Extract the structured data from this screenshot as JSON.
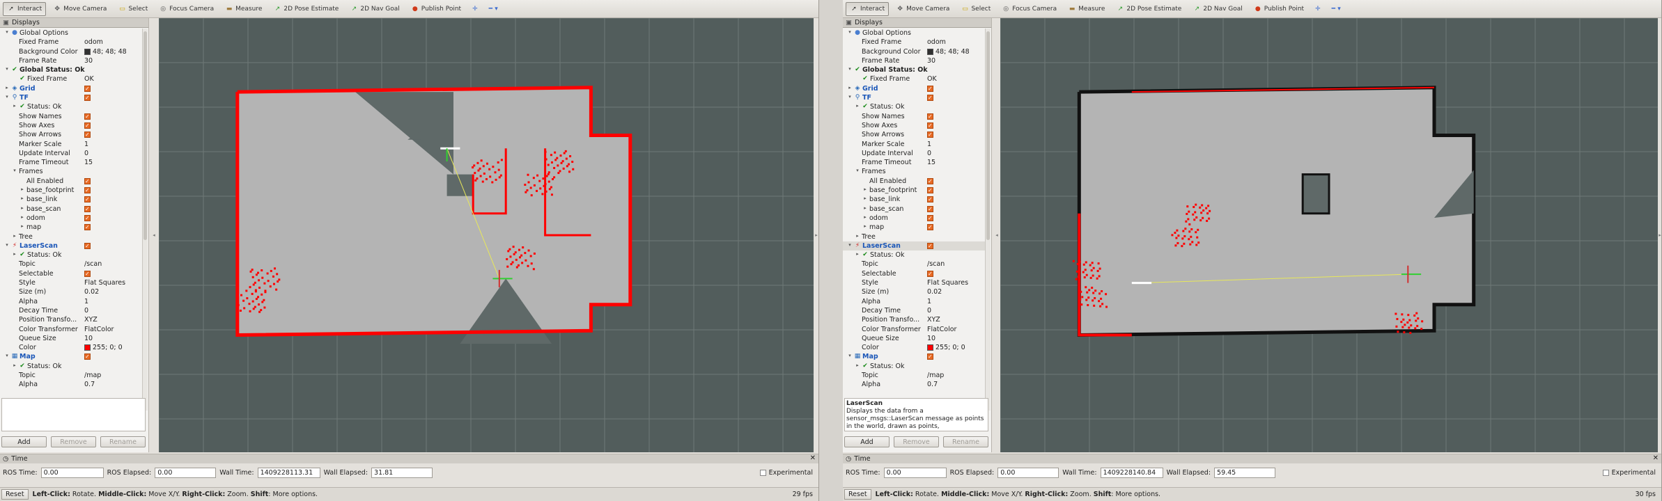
{
  "toolbar": {
    "items": [
      {
        "label": "Interact",
        "icon": "interact-icon"
      },
      {
        "label": "Move Camera",
        "icon": "move-camera-icon"
      },
      {
        "label": "Select",
        "icon": "select-icon"
      },
      {
        "label": "Focus Camera",
        "icon": "focus-camera-icon"
      },
      {
        "label": "Measure",
        "icon": "measure-icon"
      },
      {
        "label": "2D Pose Estimate",
        "icon": "pose-estimate-icon"
      },
      {
        "label": "2D Nav Goal",
        "icon": "nav-goal-icon"
      },
      {
        "label": "Publish Point",
        "icon": "publish-point-icon"
      }
    ]
  },
  "displays_panel": {
    "title": "Displays",
    "rows": [
      {
        "label": "Global Options",
        "value": "",
        "indent": 0,
        "exp": "▾",
        "icon": "globe",
        "style": ""
      },
      {
        "label": "Fixed Frame",
        "value": "odom",
        "indent": 1,
        "exp": "",
        "icon": "",
        "style": ""
      },
      {
        "label": "Background Color",
        "value": "48; 48; 48",
        "indent": 1,
        "exp": "",
        "icon": "",
        "style": "",
        "swatch": "#303030"
      },
      {
        "label": "Frame Rate",
        "value": "30",
        "indent": 1,
        "exp": "",
        "icon": "",
        "style": ""
      },
      {
        "label": "Global Status: Ok",
        "value": "",
        "indent": 0,
        "exp": "▾",
        "icon": "check",
        "style": "bold"
      },
      {
        "label": "Fixed Frame",
        "value": "OK",
        "indent": 1,
        "exp": "",
        "icon": "check",
        "style": ""
      },
      {
        "label": "Grid",
        "value": "",
        "indent": 0,
        "exp": "▸",
        "icon": "grid",
        "style": "blue",
        "checkbox": true
      },
      {
        "label": "TF",
        "value": "",
        "indent": 0,
        "exp": "▾",
        "icon": "tf",
        "style": "blue",
        "checkbox": true
      },
      {
        "label": "Status: Ok",
        "value": "",
        "indent": 1,
        "exp": "▸",
        "icon": "check",
        "style": ""
      },
      {
        "label": "Show Names",
        "value": "",
        "indent": 1,
        "exp": "",
        "icon": "",
        "style": "",
        "checkbox": true
      },
      {
        "label": "Show Axes",
        "value": "",
        "indent": 1,
        "exp": "",
        "icon": "",
        "style": "",
        "checkbox": true
      },
      {
        "label": "Show Arrows",
        "value": "",
        "indent": 1,
        "exp": "",
        "icon": "",
        "style": "",
        "checkbox": true
      },
      {
        "label": "Marker Scale",
        "value": "1",
        "indent": 1,
        "exp": "",
        "icon": "",
        "style": ""
      },
      {
        "label": "Update Interval",
        "value": "0",
        "indent": 1,
        "exp": "",
        "icon": "",
        "style": ""
      },
      {
        "label": "Frame Timeout",
        "value": "15",
        "indent": 1,
        "exp": "",
        "icon": "",
        "style": ""
      },
      {
        "label": "Frames",
        "value": "",
        "indent": 1,
        "exp": "▾",
        "icon": "",
        "style": ""
      },
      {
        "label": "All Enabled",
        "value": "",
        "indent": 2,
        "exp": "",
        "icon": "",
        "style": "",
        "checkbox": true
      },
      {
        "label": "base_footprint",
        "value": "",
        "indent": 2,
        "exp": "▸",
        "icon": "",
        "style": "",
        "checkbox": true
      },
      {
        "label": "base_link",
        "value": "",
        "indent": 2,
        "exp": "▸",
        "icon": "",
        "style": "",
        "checkbox": true
      },
      {
        "label": "base_scan",
        "value": "",
        "indent": 2,
        "exp": "▸",
        "icon": "",
        "style": "",
        "checkbox": true
      },
      {
        "label": "odom",
        "value": "",
        "indent": 2,
        "exp": "▸",
        "icon": "",
        "style": "",
        "checkbox": true
      },
      {
        "label": "map",
        "value": "",
        "indent": 2,
        "exp": "▸",
        "icon": "",
        "style": "",
        "checkbox": true
      },
      {
        "label": "Tree",
        "value": "",
        "indent": 1,
        "exp": "▸",
        "icon": "",
        "style": ""
      },
      {
        "label": "LaserScan",
        "value": "",
        "indent": 0,
        "exp": "▾",
        "icon": "laser",
        "style": "blue",
        "checkbox": true
      },
      {
        "label": "Status: Ok",
        "value": "",
        "indent": 1,
        "exp": "▸",
        "icon": "check",
        "style": ""
      },
      {
        "label": "Topic",
        "value": "/scan",
        "indent": 1,
        "exp": "",
        "icon": "",
        "style": ""
      },
      {
        "label": "Selectable",
        "value": "",
        "indent": 1,
        "exp": "",
        "icon": "",
        "style": "",
        "checkbox": true
      },
      {
        "label": "Style",
        "value": "Flat Squares",
        "indent": 1,
        "exp": "",
        "icon": "",
        "style": ""
      },
      {
        "label": "Size (m)",
        "value": "0.02",
        "indent": 1,
        "exp": "",
        "icon": "",
        "style": ""
      },
      {
        "label": "Alpha",
        "value": "1",
        "indent": 1,
        "exp": "",
        "icon": "",
        "style": ""
      },
      {
        "label": "Decay Time",
        "value": "0",
        "indent": 1,
        "exp": "",
        "icon": "",
        "style": ""
      },
      {
        "label": "Position Transfo...",
        "value": "XYZ",
        "indent": 1,
        "exp": "",
        "icon": "",
        "style": ""
      },
      {
        "label": "Color Transformer",
        "value": "FlatColor",
        "indent": 1,
        "exp": "",
        "icon": "",
        "style": ""
      },
      {
        "label": "Queue Size",
        "value": "10",
        "indent": 1,
        "exp": "",
        "icon": "",
        "style": ""
      },
      {
        "label": "Color",
        "value": "255; 0; 0",
        "indent": 1,
        "exp": "",
        "icon": "",
        "style": "",
        "swatch": "#ff0000"
      },
      {
        "label": "Map",
        "value": "",
        "indent": 0,
        "exp": "▾",
        "icon": "map",
        "style": "blue",
        "checkbox": true
      },
      {
        "label": "Status: Ok",
        "value": "",
        "indent": 1,
        "exp": "▸",
        "icon": "check",
        "style": ""
      },
      {
        "label": "Topic",
        "value": "/map",
        "indent": 1,
        "exp": "",
        "icon": "",
        "style": ""
      },
      {
        "label": "Alpha",
        "value": "0.7",
        "indent": 1,
        "exp": "",
        "icon": "",
        "style": ""
      }
    ],
    "buttons": {
      "add": "Add",
      "remove": "Remove",
      "rename": "Rename"
    }
  },
  "windows": [
    {
      "description": {
        "title": "",
        "text": ""
      },
      "time": {
        "title": "Time",
        "ros_time_label": "ROS Time:",
        "ros_time": "0.00",
        "ros_elapsed_label": "ROS Elapsed:",
        "ros_elapsed": "0.00",
        "wall_time_label": "Wall Time:",
        "wall_time": "1409228113.31",
        "wall_elapsed_label": "Wall Elapsed:",
        "wall_elapsed": "31.81",
        "experimental": "Experimental"
      },
      "status": {
        "reset": "Reset",
        "hint_bold1": "Left-Click:",
        "hint1": " Rotate. ",
        "hint_bold2": "Middle-Click:",
        "hint2": " Move X/Y. ",
        "hint_bold3": "Right-Click:",
        "hint3": " Zoom. ",
        "hint_bold4": "Shift",
        "hint4": ": More options.",
        "fps": "29 fps"
      }
    },
    {
      "description": {
        "title": "LaserScan",
        "text": "Displays the data from a sensor_msgs::LaserScan message as points in the world, drawn as points,"
      },
      "time": {
        "title": "Time",
        "ros_time_label": "ROS Time:",
        "ros_time": "0.00",
        "ros_elapsed_label": "ROS Elapsed:",
        "ros_elapsed": "0.00",
        "wall_time_label": "Wall Time:",
        "wall_time": "1409228140.84",
        "wall_elapsed_label": "Wall Elapsed:",
        "wall_elapsed": "59.45",
        "experimental": "Experimental"
      },
      "status": {
        "reset": "Reset",
        "hint_bold1": "Left-Click:",
        "hint1": " Rotate. ",
        "hint_bold2": "Middle-Click:",
        "hint2": " Move X/Y. ",
        "hint_bold3": "Right-Click:",
        "hint3": " Zoom. ",
        "hint_bold4": "Shift",
        "hint4": ": More options.",
        "fps": "30 fps"
      }
    }
  ],
  "colors": {
    "view_bg": "#525d5c",
    "grid": "#6f7977",
    "free": "#b4b4b4",
    "unknown": "#5f6968",
    "wall": "#111111",
    "laser": "#ff0000"
  }
}
